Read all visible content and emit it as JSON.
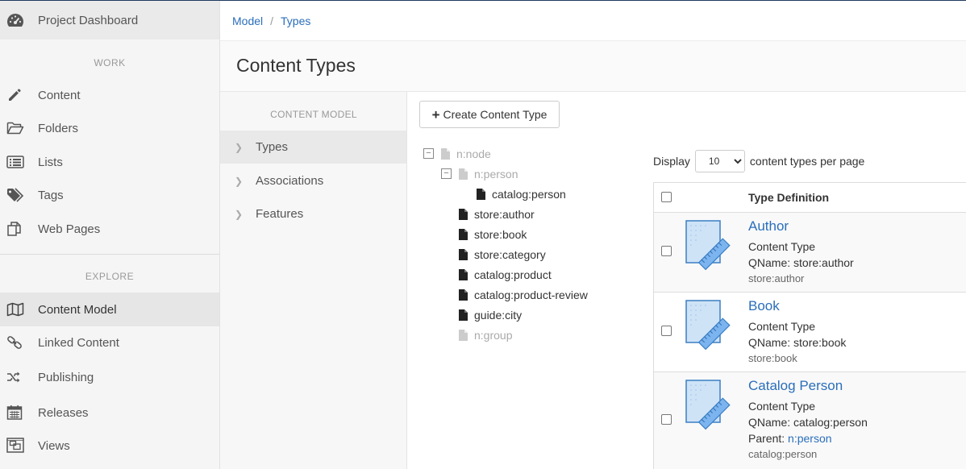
{
  "sidebar": {
    "dashboard_label": "Project Dashboard",
    "work_section": "WORK",
    "work_items": [
      {
        "label": "Content",
        "icon": "pencil-icon"
      },
      {
        "label": "Folders",
        "icon": "folder-open-icon"
      },
      {
        "label": "Lists",
        "icon": "list-icon"
      },
      {
        "label": "Tags",
        "icon": "tags-icon"
      },
      {
        "label": "Web Pages",
        "icon": "web-pages-icon"
      }
    ],
    "explore_section": "EXPLORE",
    "explore_items": [
      {
        "label": "Content Model",
        "icon": "map-icon",
        "active": true
      },
      {
        "label": "Linked Content",
        "icon": "link-icon"
      },
      {
        "label": "Publishing",
        "icon": "shuffle-icon"
      },
      {
        "label": "Releases",
        "icon": "calendar-icon"
      },
      {
        "label": "Views",
        "icon": "views-icon"
      }
    ]
  },
  "breadcrumb": {
    "items": [
      "Model",
      "Types"
    ]
  },
  "page": {
    "title": "Content Types"
  },
  "subnav": {
    "title": "CONTENT MODEL",
    "items": [
      {
        "label": "Types",
        "active": true
      },
      {
        "label": "Associations"
      },
      {
        "label": "Features"
      }
    ]
  },
  "toolbar": {
    "create_label": "Create Content Type"
  },
  "tree": {
    "nodes": [
      {
        "label": "n:node",
        "muted": true
      },
      {
        "label": "n:person",
        "muted": true
      },
      {
        "label": "catalog:person"
      },
      {
        "label": "store:author"
      },
      {
        "label": "store:book"
      },
      {
        "label": "store:category"
      },
      {
        "label": "catalog:product"
      },
      {
        "label": "catalog:product-review"
      },
      {
        "label": "guide:city"
      },
      {
        "label": "n:group",
        "muted": true
      }
    ]
  },
  "pagination": {
    "display_label": "Display",
    "per_page_value": "10",
    "per_page_suffix": "content types per page"
  },
  "table": {
    "header": "Type Definition",
    "rows": [
      {
        "title": "Author",
        "kind": "Content Type",
        "qname": "QName: store:author",
        "id": "store:author"
      },
      {
        "title": "Book",
        "kind": "Content Type",
        "qname": "QName: store:book",
        "id": "store:book"
      },
      {
        "title": "Catalog Person",
        "kind": "Content Type",
        "qname": "QName: catalog:person",
        "parent_label": "Parent:",
        "parent_link": "n:person",
        "id": "catalog:person"
      }
    ]
  },
  "colors": {
    "link": "#2a6ebb",
    "thumb_fill": "#cfe3f7",
    "thumb_stroke": "#3b7fc4",
    "ruler": "#7cb4ef"
  }
}
